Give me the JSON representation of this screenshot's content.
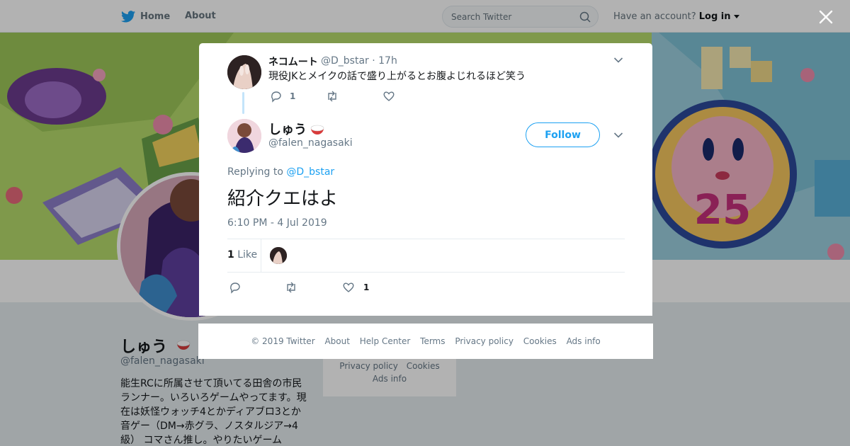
{
  "topbar": {
    "home_label": "Home",
    "about_label": "About",
    "search_placeholder": "Search Twitter",
    "have_account": "Have an account?",
    "login_label": "Log in"
  },
  "profile": {
    "name": "しゅう",
    "handle": "@falen_nagasaki",
    "bio": "能生RCに所属させて頂いてる田舎の市民ランナー。いろいろゲームやってます。現在は妖怪ウォッチ4とかディアブロ3とか音ゲー（DM→赤グラ、ノスタルジア→4級） コマさん推し。やりたいゲーム",
    "sidebar_footer": [
      "Privacy policy",
      "Cookies",
      "Ads info"
    ]
  },
  "modal": {
    "parent": {
      "name": "ネコムート",
      "handle_time": "@D_bstar · 17h",
      "text": "現役JKとメイクの話で盛り上がるとお腹よじれるほど笑う",
      "reply_count": "1"
    },
    "tweet": {
      "name": "しゅう",
      "handle": "@falen_nagasaki",
      "follow_label": "Follow",
      "replying_prefix": "Replying to",
      "replying_to": "@D_bstar",
      "text": "紹介クエはよ",
      "timestamp": "6:10 PM - 4 Jul 2019",
      "likes_number": "1",
      "likes_label": "Like",
      "like_count": "1"
    }
  },
  "footer_links": [
    "© 2019 Twitter",
    "About",
    "Help Center",
    "Terms",
    "Privacy policy",
    "Cookies",
    "Ads info"
  ],
  "icons": {
    "bird": "twitter-bird-icon",
    "search": "search-icon",
    "close": "close-icon",
    "chevron": "chevron-down-icon",
    "reply": "reply-icon",
    "retweet": "retweet-icon",
    "like": "heart-icon",
    "rice": "rice-bowl-emoji"
  },
  "colors": {
    "accent": "#1da1f2",
    "text": "#14171a",
    "muted": "#657786"
  }
}
